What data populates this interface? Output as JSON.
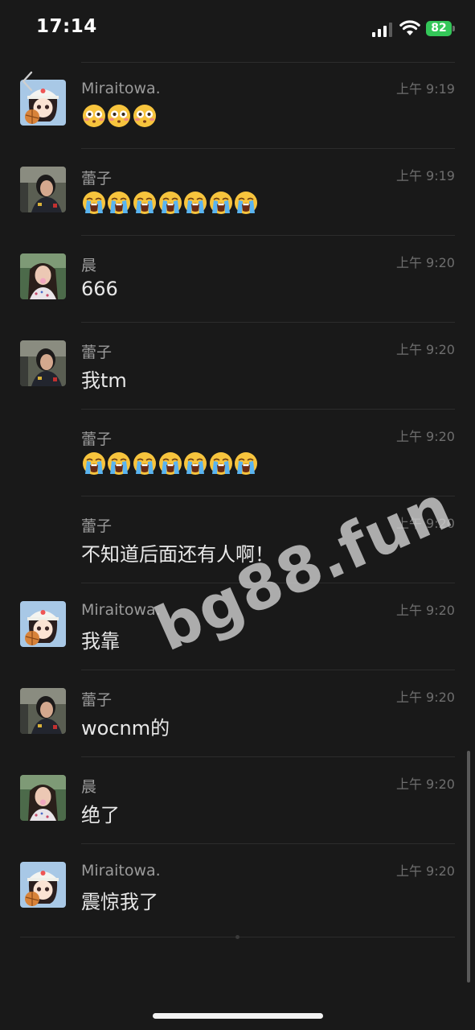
{
  "status_bar": {
    "time": "17:14",
    "battery": "82"
  },
  "messages": [
    {
      "sender": "Miraitowa.",
      "time": "上午 9:19",
      "type": "emoji",
      "emoji": "flushed-face",
      "count": 3,
      "avatar": "anime-girl-avatar"
    },
    {
      "sender": "蕾子",
      "time": "上午 9:19",
      "type": "emoji",
      "emoji": "loudly-crying-face",
      "count": 7,
      "avatar": "girl-photo-avatar"
    },
    {
      "sender": "晨",
      "time": "上午 9:20",
      "type": "text",
      "text": "666",
      "avatar": "girl-photo-avatar-2"
    },
    {
      "sender": "蕾子",
      "time": "上午 9:20",
      "type": "text",
      "text": "我tm",
      "avatar": "girl-photo-avatar"
    },
    {
      "sender": "蕾子",
      "time": "上午 9:20",
      "type": "emoji",
      "emoji": "loudly-crying-face",
      "count": 7,
      "avatar": ""
    },
    {
      "sender": "蕾子",
      "time": "上午 9:20",
      "type": "text",
      "text": "不知道后面还有人啊！",
      "avatar": ""
    },
    {
      "sender": "Miraitowa.",
      "time": "上午 9:20",
      "type": "text",
      "text": "我靠",
      "avatar": "anime-girl-avatar"
    },
    {
      "sender": "蕾子",
      "time": "上午 9:20",
      "type": "text",
      "text": "wocnm的",
      "avatar": "girl-photo-avatar"
    },
    {
      "sender": "晨",
      "time": "上午 9:20",
      "type": "text",
      "text": "绝了",
      "avatar": "girl-photo-avatar-2"
    },
    {
      "sender": "Miraitowa.",
      "time": "上午 9:20",
      "type": "text",
      "text": "震惊我了",
      "avatar": "anime-girl-avatar"
    }
  ],
  "watermark": "bg88.fun",
  "colors": {
    "background": "#191919",
    "battery": "#34c759"
  }
}
